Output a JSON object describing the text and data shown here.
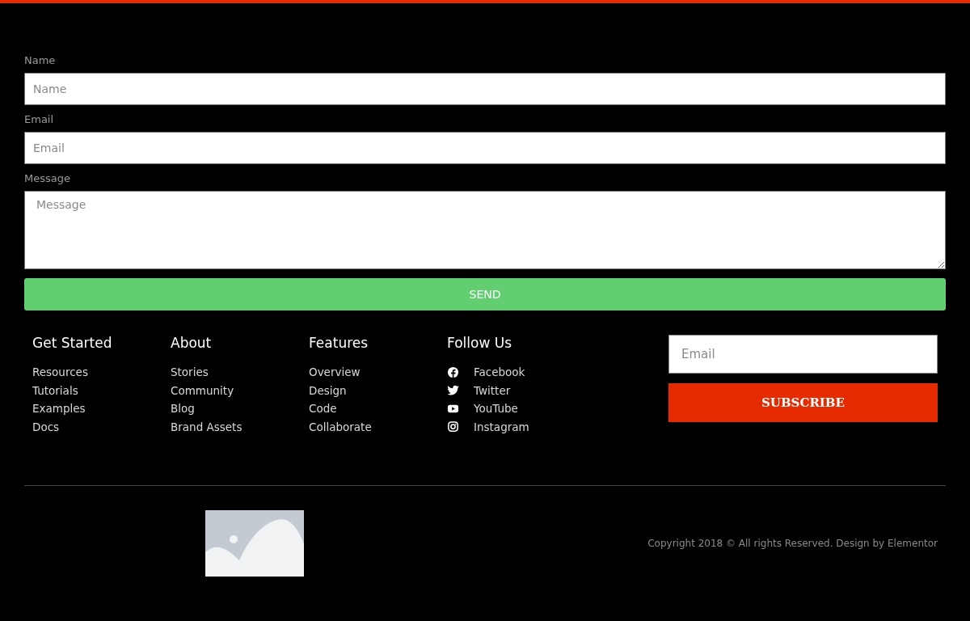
{
  "contact_form": {
    "fields": [
      {
        "kind": "input",
        "label": "Name",
        "placeholder": "Name"
      },
      {
        "kind": "input",
        "label": "Email",
        "placeholder": "Email"
      },
      {
        "kind": "textarea",
        "label": "Message",
        "placeholder": "Message"
      }
    ],
    "submit": "SEND"
  },
  "footer": {
    "columns": [
      {
        "heading": "Get Started",
        "links": [
          {
            "label": "Resources"
          },
          {
            "label": "Tutorials"
          },
          {
            "label": "Examples"
          },
          {
            "label": "Docs"
          }
        ]
      },
      {
        "heading": "About",
        "links": [
          {
            "label": "Stories"
          },
          {
            "label": "Community"
          },
          {
            "label": "Blog"
          },
          {
            "label": "Brand Assets"
          }
        ]
      },
      {
        "heading": "Features",
        "links": [
          {
            "label": "Overview"
          },
          {
            "label": "Design"
          },
          {
            "label": "Code"
          },
          {
            "label": "Collaborate"
          }
        ]
      },
      {
        "heading": "Follow Us",
        "links": [
          {
            "label": "Facebook",
            "kind": "facebook"
          },
          {
            "label": "Twitter",
            "kind": "twitter"
          },
          {
            "label": "YouTube",
            "kind": "youtube"
          },
          {
            "label": "Instagram",
            "kind": "instagram"
          }
        ]
      }
    ],
    "newsletter": {
      "placeholder": "Email",
      "button": "SUBSCRIBE"
    },
    "copyright": "Copyright 2018 © All rights Reserved. Design by Elementor"
  }
}
